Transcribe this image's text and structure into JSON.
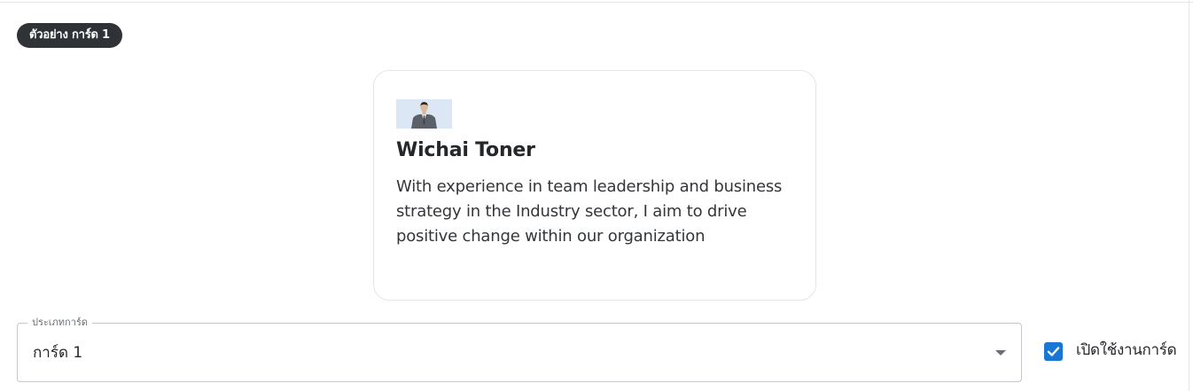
{
  "preview": {
    "chip_label": "ตัวอย่าง การ์ด 1"
  },
  "card": {
    "avatar_alt": "profile photo",
    "name": "Wichai Toner",
    "bio": "With experience in team leadership and business strategy in the Industry sector, I aim to drive positive change within our organization"
  },
  "form": {
    "card_type_label": "ประเภทการ์ด",
    "card_type_value": "การ์ด 1",
    "enable_label": "เปิดใช้งานการ์ด",
    "enable_checked": true
  },
  "colors": {
    "accent": "#1976d2",
    "chip_bg": "#2f3338",
    "card_border": "#e3e5e8"
  }
}
